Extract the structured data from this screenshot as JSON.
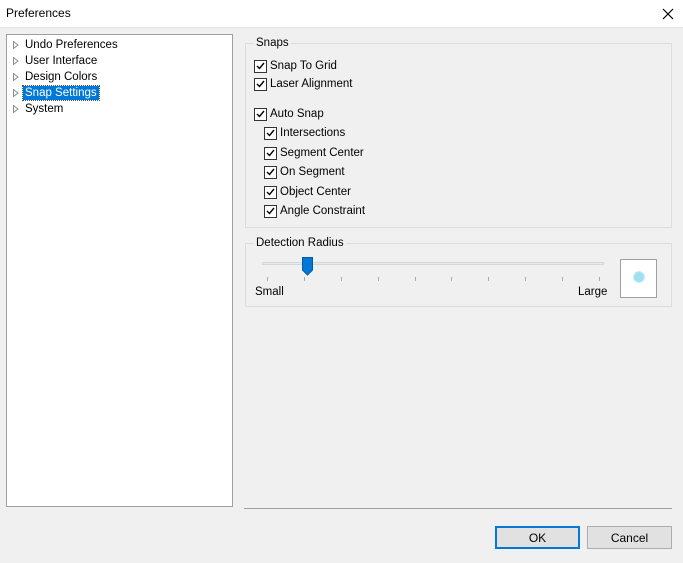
{
  "window": {
    "title": "Preferences",
    "close_icon": "close-icon"
  },
  "tree": {
    "items": [
      {
        "label": "Undo Preferences",
        "selected": false
      },
      {
        "label": "User Interface",
        "selected": false
      },
      {
        "label": "Design Colors",
        "selected": false
      },
      {
        "label": "Snap Settings",
        "selected": true
      },
      {
        "label": "System",
        "selected": false
      }
    ]
  },
  "snaps": {
    "title": "Snaps",
    "snap_to_grid": {
      "label": "Snap To Grid",
      "checked": true
    },
    "laser_alignment": {
      "label": "Laser Alignment",
      "checked": true
    },
    "auto_snap": {
      "label": "Auto Snap",
      "checked": true
    },
    "sub": [
      {
        "label": "Intersections",
        "checked": true
      },
      {
        "label": "Segment Center",
        "checked": true
      },
      {
        "label": "On Segment",
        "checked": true
      },
      {
        "label": "Object Center",
        "checked": true
      },
      {
        "label": "Angle Constraint",
        "checked": true
      }
    ]
  },
  "detection": {
    "title": "Detection Radius",
    "min_label": "Small",
    "max_label": "Large",
    "level_fraction": 0.12
  },
  "buttons": {
    "ok": "OK",
    "cancel": "Cancel"
  },
  "colors": {
    "accent": "#0078d7",
    "preview_dot": "#9fe0ef"
  }
}
